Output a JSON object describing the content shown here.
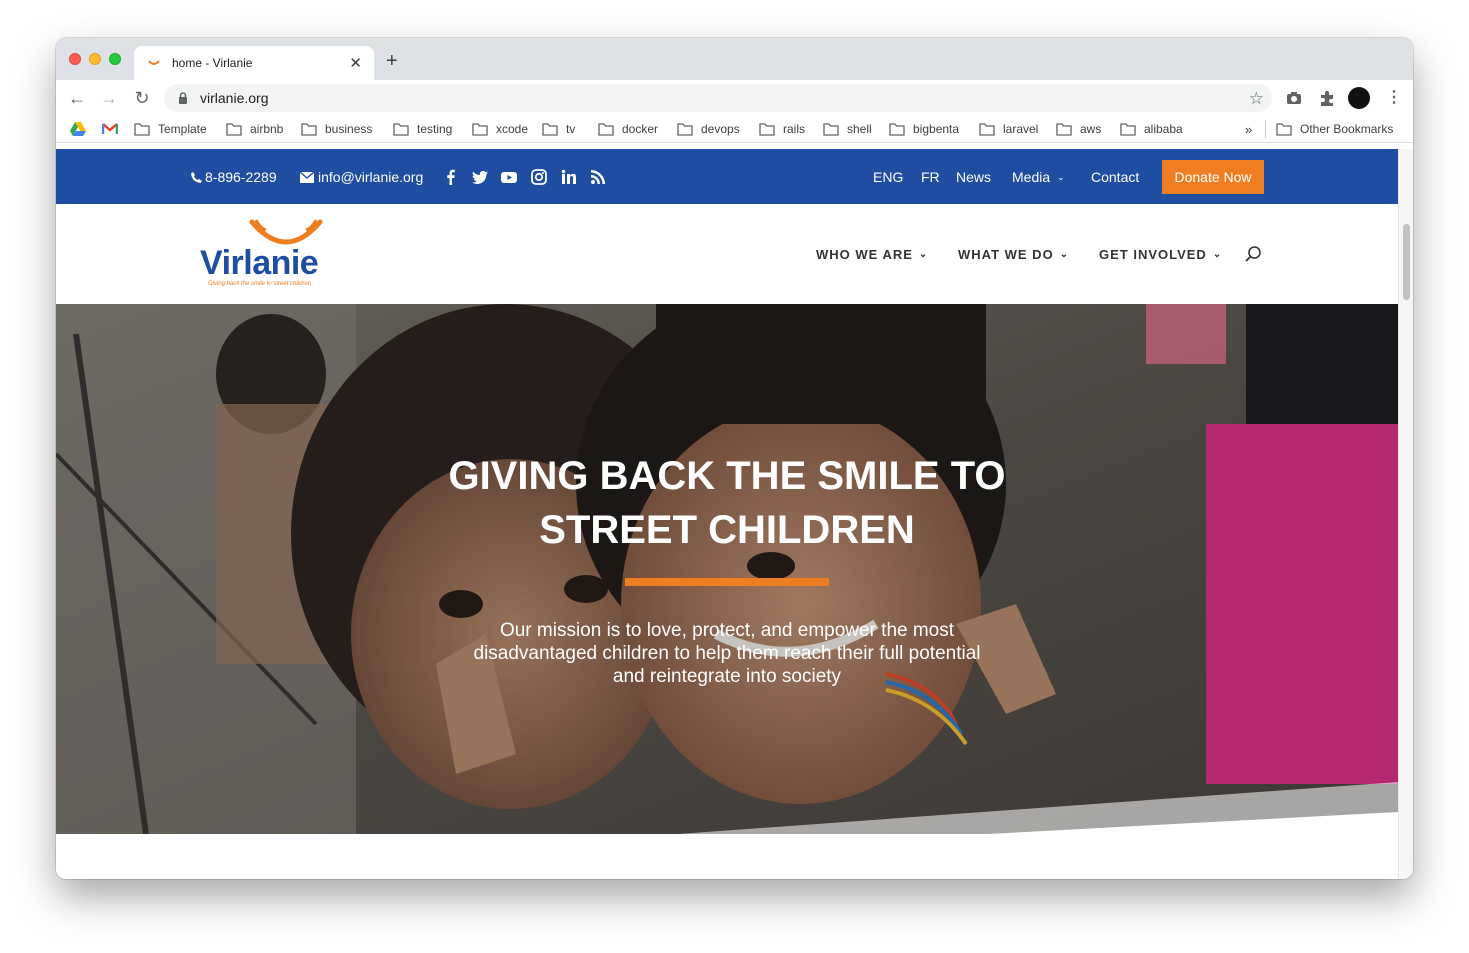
{
  "browser": {
    "tab_title": "home - Virlanie",
    "url": "virlanie.org",
    "bookmarks": [
      "Template",
      "airbnb",
      "business",
      "testing",
      "xcode",
      "tv",
      "docker",
      "devops",
      "rails",
      "shell",
      "bigbenta",
      "laravel",
      "aws",
      "alibaba"
    ],
    "bookmarks_overflow": "»",
    "other_bookmarks": "Other Bookmarks"
  },
  "topbar": {
    "phone": "8-896-2289",
    "email": "info@virlanie.org",
    "social": [
      "facebook-icon",
      "twitter-icon",
      "youtube-icon",
      "instagram-icon",
      "linkedin-icon",
      "rss-icon"
    ],
    "links": {
      "eng": "ENG",
      "fr": "FR",
      "news": "News",
      "media": "Media",
      "contact": "Contact"
    },
    "donate": "Donate Now",
    "bg_color": "#1e4da1",
    "accent_color": "#ef7d22"
  },
  "header": {
    "logo_text": "Virlanie",
    "logo_tagline": "Giving back the smile to street children",
    "menu": {
      "who": "WHO WE ARE",
      "what": "WHAT WE DO",
      "involved": "GET INVOLVED"
    }
  },
  "hero": {
    "title_line1": "GIVING BACK THE SMILE TO",
    "title_line2": "STREET CHILDREN",
    "mission_line1": "Our mission is to love, protect, and empower the most",
    "mission_line2": "disadvantaged children to help them reach their full potential",
    "mission_line3": "and reintegrate into society"
  }
}
